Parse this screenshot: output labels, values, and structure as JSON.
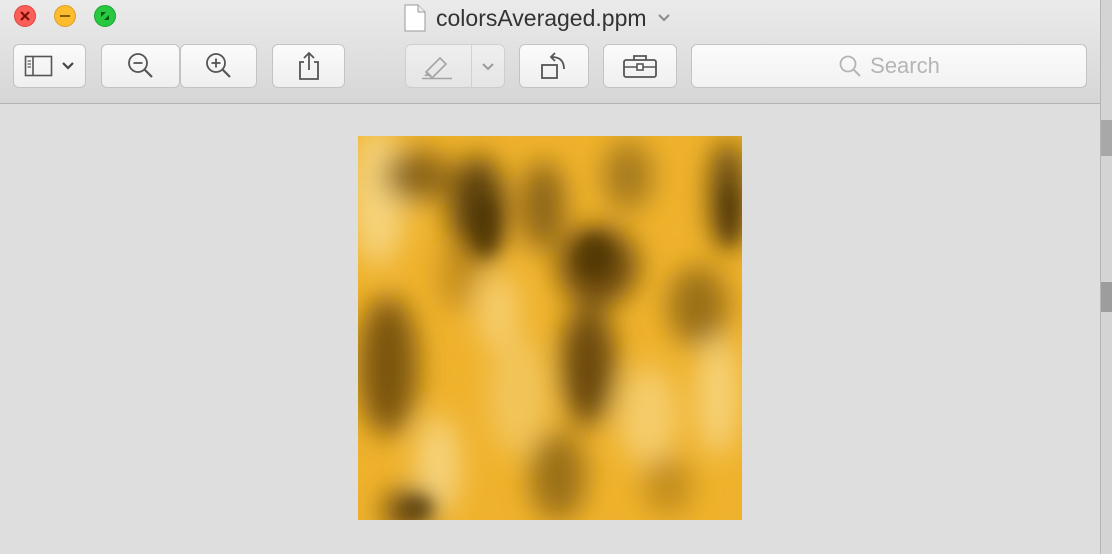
{
  "window": {
    "title": "colorsAveraged.ppm"
  },
  "toolbar": {
    "sidebar_button": {
      "icon": "sidebar-icon",
      "dropdown": "chevron-down-icon"
    },
    "zoom_out": {
      "icon": "zoom-out-icon"
    },
    "zoom_in": {
      "icon": "zoom-in-icon"
    },
    "share": {
      "icon": "share-icon"
    },
    "markup": {
      "icon": "highlighter-icon",
      "dropdown": "chevron-down-icon",
      "state": "disabled"
    },
    "rotate": {
      "icon": "rotate-left-icon"
    },
    "toolbox": {
      "icon": "toolbox-icon"
    },
    "search": {
      "placeholder": "Search",
      "icon": "search-icon"
    }
  },
  "document": {
    "content": "yellow-brown marbled noise image"
  },
  "colors": {
    "image_base": "#f0b32a",
    "image_dark": "#6b4a0c",
    "image_light": "#f7d27a"
  }
}
